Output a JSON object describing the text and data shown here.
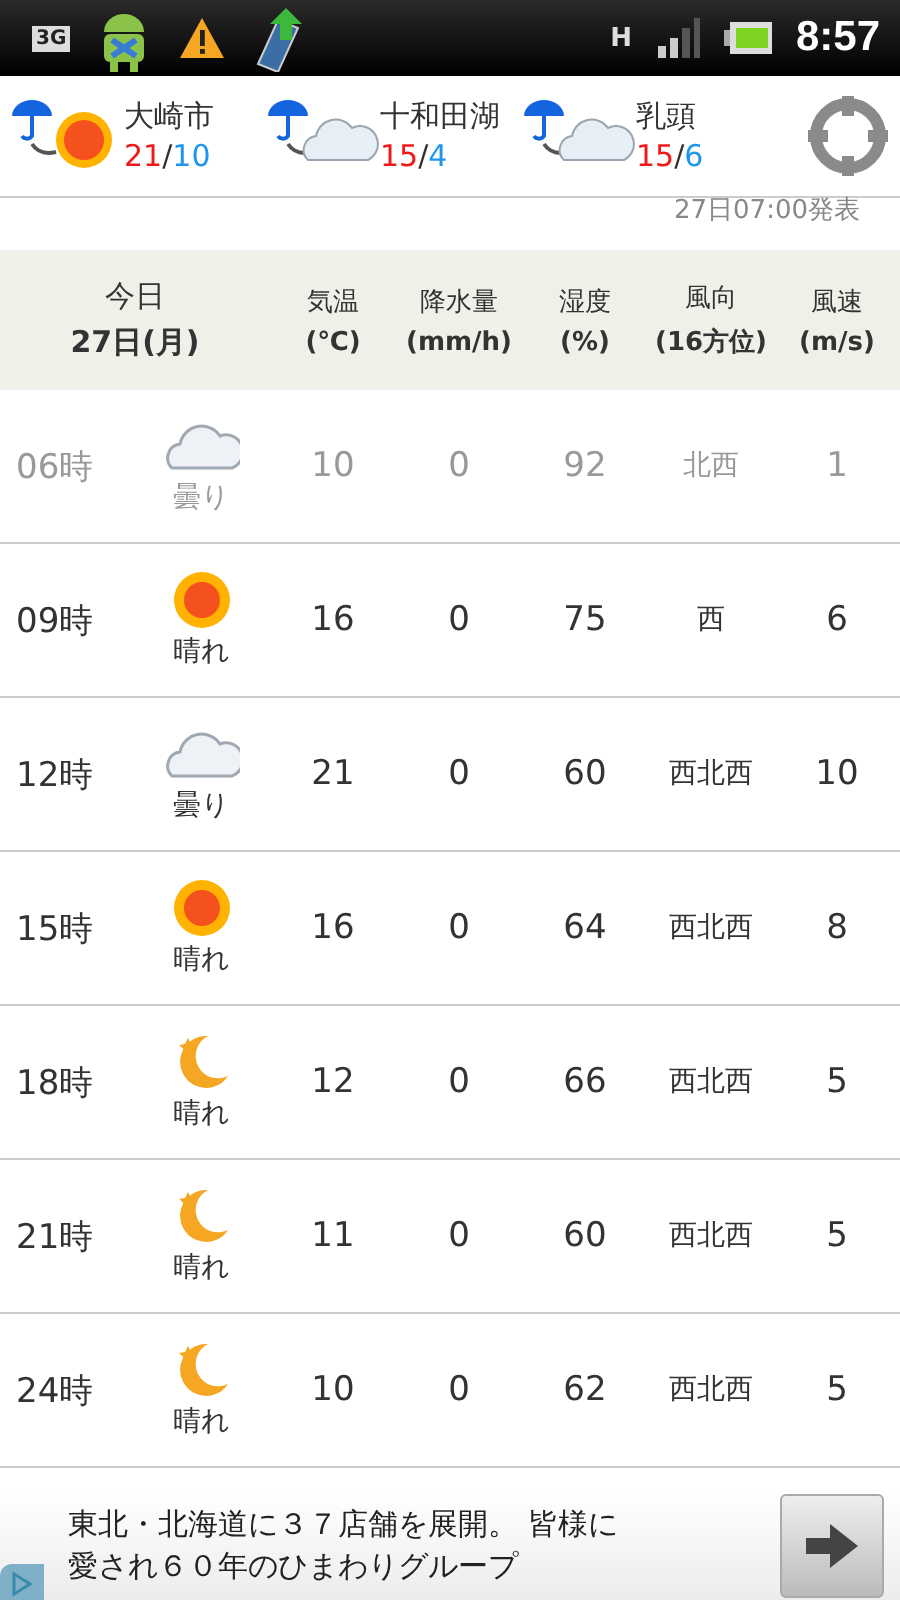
{
  "status_bar": {
    "time": "8:57",
    "network_badge": "3G",
    "data_badge": "H"
  },
  "locations": [
    {
      "name": "大崎市",
      "high": "21",
      "separator": "/",
      "low": "10",
      "kind": "sunny"
    },
    {
      "name": "十和田湖",
      "high": "15",
      "separator": "/",
      "low": "4",
      "kind": "cloudy"
    },
    {
      "name": "乳頭",
      "high": "15",
      "separator": "/",
      "low": "6",
      "kind": "cloudy"
    }
  ],
  "issued": "27日07:00発表",
  "table": {
    "day": "今日",
    "date": "27日(月)",
    "columns": [
      {
        "label": "気温",
        "unit": "(℃)"
      },
      {
        "label": "降水量",
        "unit": "(mm/h)"
      },
      {
        "label": "湿度",
        "unit": "(%)"
      },
      {
        "label": "風向",
        "unit": "(16方位)"
      },
      {
        "label": "風速",
        "unit": "(m/s)"
      }
    ],
    "rows": [
      {
        "time": "06時",
        "kind": "cloudy",
        "weather": "曇り",
        "temp": "10",
        "precip": "0",
        "humidity": "92",
        "wind_dir": "北西",
        "wind_speed": "1",
        "past": true
      },
      {
        "time": "09時",
        "kind": "sunny",
        "weather": "晴れ",
        "temp": "16",
        "precip": "0",
        "humidity": "75",
        "wind_dir": "西",
        "wind_speed": "6",
        "past": false
      },
      {
        "time": "12時",
        "kind": "cloudy",
        "weather": "曇り",
        "temp": "21",
        "precip": "0",
        "humidity": "60",
        "wind_dir": "西北西",
        "wind_speed": "10",
        "past": false
      },
      {
        "time": "15時",
        "kind": "sunny",
        "weather": "晴れ",
        "temp": "16",
        "precip": "0",
        "humidity": "64",
        "wind_dir": "西北西",
        "wind_speed": "8",
        "past": false
      },
      {
        "time": "18時",
        "kind": "moon",
        "weather": "晴れ",
        "temp": "12",
        "precip": "0",
        "humidity": "66",
        "wind_dir": "西北西",
        "wind_speed": "5",
        "past": false
      },
      {
        "time": "21時",
        "kind": "moon",
        "weather": "晴れ",
        "temp": "11",
        "precip": "0",
        "humidity": "60",
        "wind_dir": "西北西",
        "wind_speed": "5",
        "past": false
      },
      {
        "time": "24時",
        "kind": "moon",
        "weather": "晴れ",
        "temp": "10",
        "precip": "0",
        "humidity": "62",
        "wind_dir": "西北西",
        "wind_speed": "5",
        "past": false
      }
    ]
  },
  "ad": {
    "lines": [
      "東北・北海道に３７店舗を展開。 皆様に",
      "愛され６０年のひまわりグループ"
    ]
  }
}
